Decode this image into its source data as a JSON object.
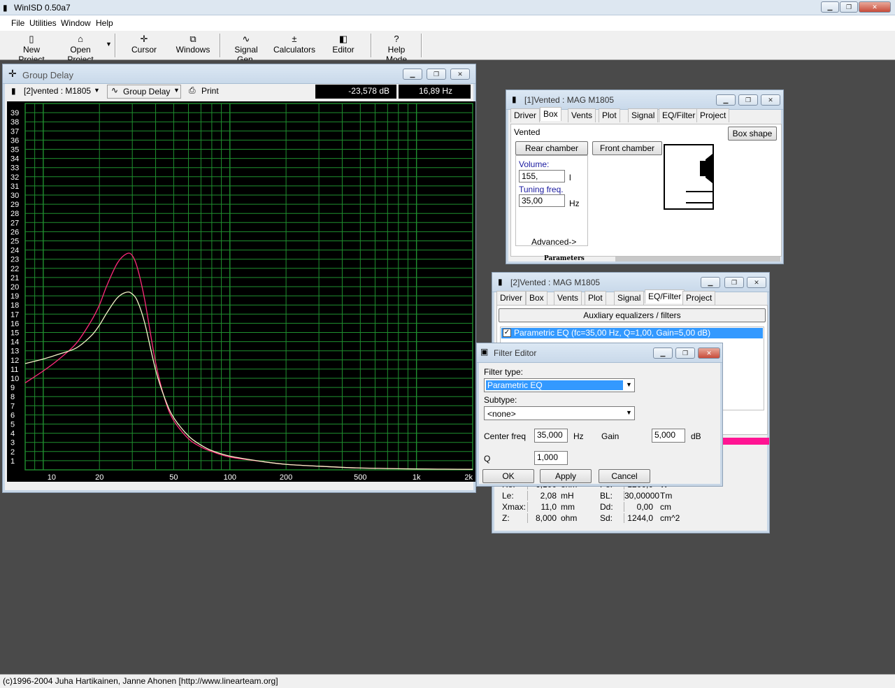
{
  "app": {
    "title": "WinISD 0.50a7",
    "status": "(c)1996-2004 Juha Hartikainen, Janne Ahonen [http://www.linearteam.org]"
  },
  "menu": [
    "File",
    "Utilities",
    "Window",
    "Help"
  ],
  "toolbar": [
    {
      "label": "New Project",
      "icon": "new-project-icon"
    },
    {
      "label": "Open Project",
      "icon": "open-project-icon"
    },
    {
      "label": "Cursor",
      "icon": "cursor-icon"
    },
    {
      "label": "Windows",
      "icon": "windows-icon"
    },
    {
      "label": "Signal Gen.",
      "icon": "signal-gen-icon"
    },
    {
      "label": "Calculators",
      "icon": "calculators-icon"
    },
    {
      "label": "Editor",
      "icon": "editor-icon"
    },
    {
      "label": "Help Mode",
      "icon": "help-icon"
    }
  ],
  "graph": {
    "title": "Group Delay",
    "project_select": "[2]vented : M1805",
    "mode_select": "Group Delay",
    "print_label": "Print",
    "readout_db": "-23,578 dB",
    "readout_hz": "16,89 Hz"
  },
  "chart_data": {
    "type": "line",
    "xscale": "log",
    "xlim": [
      8,
      2000
    ],
    "ylim": [
      0,
      40
    ],
    "x_tick_labels": [
      "10",
      "20",
      "50",
      "100",
      "200",
      "500",
      "1k",
      "2k"
    ],
    "x_ticks": [
      10,
      20,
      50,
      100,
      200,
      500,
      1000,
      2000
    ],
    "y_tick_labels": [
      "1",
      "2",
      "3",
      "4",
      "5",
      "6",
      "7",
      "8",
      "9",
      "10",
      "11",
      "12",
      "13",
      "14",
      "15",
      "16",
      "17",
      "18",
      "19",
      "20",
      "21",
      "22",
      "23",
      "24",
      "25",
      "26",
      "27",
      "28",
      "29",
      "30",
      "31",
      "32",
      "33",
      "34",
      "35",
      "36",
      "37",
      "38",
      "39"
    ],
    "grid": true,
    "background": "#000000",
    "grid_color": "#1f8f2f",
    "series": [
      {
        "color": "#ff2a7a",
        "x": [
          8,
          10,
          12,
          15,
          18,
          20,
          22,
          25,
          28,
          30,
          32,
          35,
          40,
          45,
          50,
          60,
          70,
          80,
          100,
          150,
          200,
          300,
          500,
          1000,
          2000
        ],
        "y": [
          9.5,
          10.8,
          12,
          13.8,
          16.2,
          18,
          20.2,
          22.6,
          23.6,
          23.4,
          22,
          18.5,
          11.7,
          7.6,
          5.4,
          3.4,
          2.5,
          2,
          1.4,
          0.9,
          0.6,
          0.4,
          0.2,
          0.1,
          0.05
        ]
      },
      {
        "color": "#f4f4c8",
        "x": [
          8,
          10,
          12,
          15,
          18,
          20,
          22,
          25,
          28,
          30,
          32,
          35,
          40,
          45,
          50,
          60,
          70,
          80,
          100,
          150,
          200,
          300,
          500,
          1000,
          2000
        ],
        "y": [
          11.6,
          12.1,
          12.6,
          13.3,
          14.6,
          15.8,
          17.2,
          18.8,
          19.4,
          19.2,
          18.4,
          16,
          10.9,
          7.7,
          5.7,
          3.7,
          2.7,
          2.1,
          1.5,
          0.9,
          0.6,
          0.4,
          0.2,
          0.1,
          0.05
        ]
      }
    ]
  },
  "box_window": {
    "title": "[1]Vented : MAG  M1805",
    "tabs": [
      "Driver",
      "Box",
      "Vents",
      "Plot",
      "Signal",
      "EQ/Filter",
      "Project"
    ],
    "box_type": "Vented",
    "box_shape_btn": "Box shape",
    "rear_tab": "Rear chamber",
    "front_tab": "Front chamber",
    "volume_label": "Volume:",
    "volume_value": "155,",
    "volume_unit": "l",
    "tuning_label": "Tuning freq.",
    "tuning_value": "35,00",
    "tuning_unit": "Hz",
    "advanced_label": "Advanced->",
    "params_label": "Parameters"
  },
  "eq_window": {
    "title": "[2]Vented : MAG  M1805",
    "tabs": [
      "Driver",
      "Box",
      "Vents",
      "Plot",
      "Signal",
      "EQ/Filter",
      "Project"
    ],
    "aux_btn": "Auxliary equalizers / filters",
    "eq_item": "Parametric EQ (fc=35,00 Hz, Q=1,00, Gain=5,00 dB)",
    "params": [
      {
        "l1": "Re:",
        "v1": "6,100",
        "u1": "ohm",
        "l2": "Pe:",
        "v2": "1200,0",
        "u2": "W"
      },
      {
        "l1": "Le:",
        "v1": "2,08",
        "u1": "mH",
        "l2": "BL:",
        "v2": "30,00000",
        "u2": "Tm"
      },
      {
        "l1": "Xmax:",
        "v1": "11,0",
        "u1": "mm",
        "l2": "Dd:",
        "v2": "0,00",
        "u2": "cm"
      },
      {
        "l1": "Z:",
        "v1": "8,000",
        "u1": "ohm",
        "l2": "Sd:",
        "v2": "1244,0",
        "u2": "cm^2"
      }
    ]
  },
  "filter_editor": {
    "title": "Filter Editor",
    "filter_type_label": "Filter type:",
    "filter_type": "Parametric EQ",
    "subtype_label": "Subtype:",
    "subtype": "<none>",
    "center_label": "Center freq",
    "center_value": "35,000",
    "center_unit": "Hz",
    "gain_label": "Gain",
    "gain_value": "5,000",
    "gain_unit": "dB",
    "q_label": "Q",
    "q_value": "1,000",
    "ok": "OK",
    "apply": "Apply",
    "cancel": "Cancel"
  }
}
